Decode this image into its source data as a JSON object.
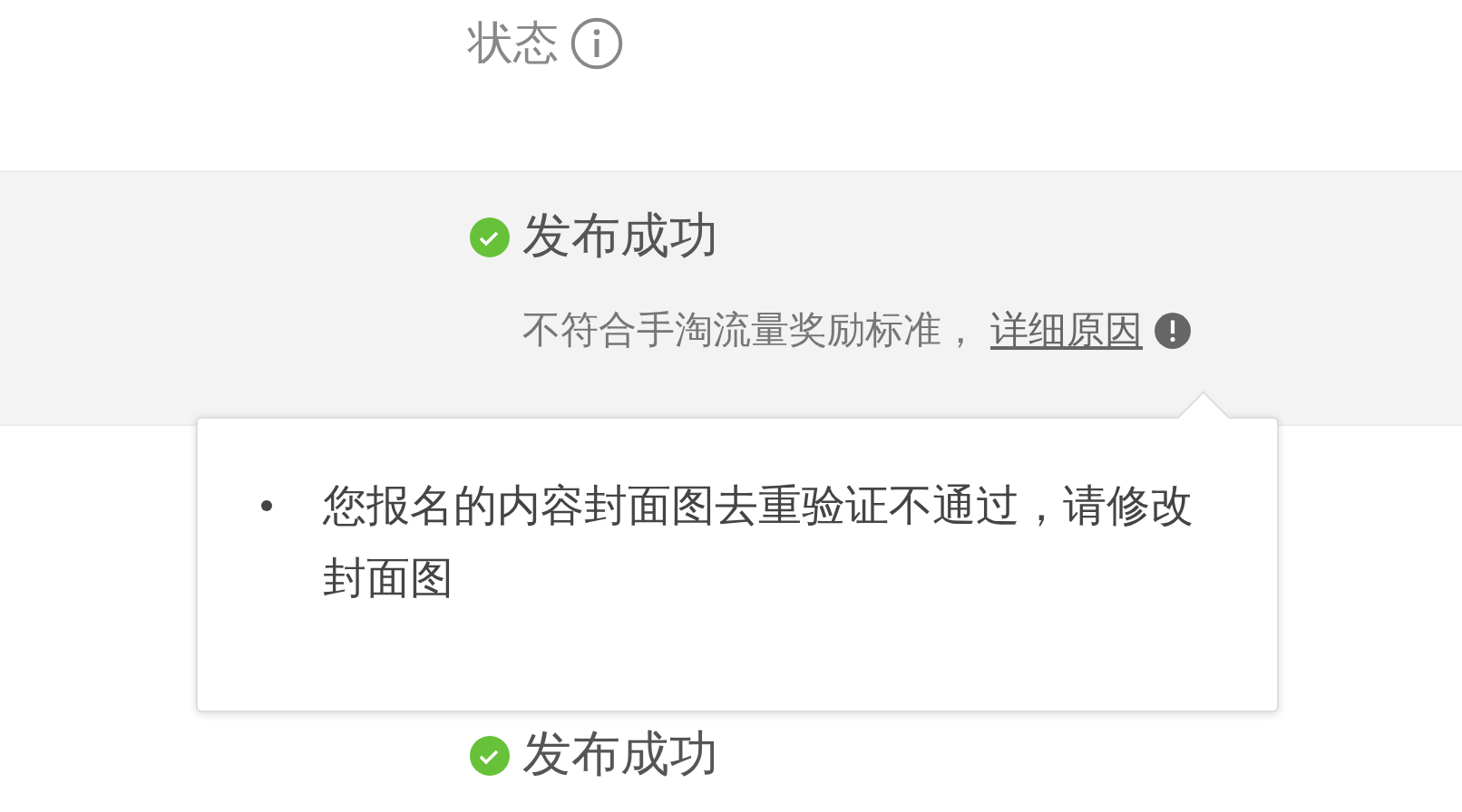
{
  "table": {
    "columns": [
      {
        "label": "状态",
        "info_icon": true
      }
    ],
    "rows": [
      {
        "status": "发布成功",
        "published": true,
        "note": "不符合手淘流量奖励标准，",
        "link": "详细原因",
        "highlighted": true
      },
      {},
      {
        "status": "发布成功",
        "published": true
      }
    ]
  },
  "tooltip": {
    "items": [
      "您报名的内容封面图去重验证不通过，请修改封面图"
    ]
  }
}
